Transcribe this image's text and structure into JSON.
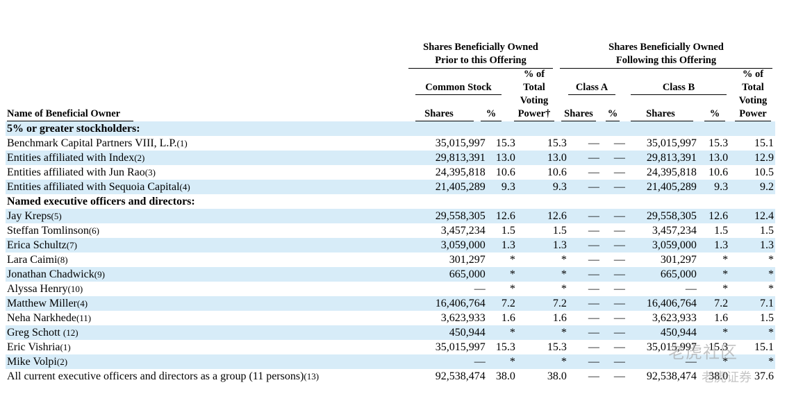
{
  "headers": {
    "group_prior_line1": "Shares Beneficially Owned",
    "group_prior_line2": "Prior to this Offering",
    "group_following_line1": "Shares Beneficially Owned",
    "group_following_line2": "Following this Offering",
    "common_stock": "Common Stock",
    "pct_total_voting_prior": [
      "% of",
      "Total",
      "Voting",
      "Power†"
    ],
    "class_a": "Class A",
    "class_b": "Class B",
    "pct_total_voting_following": [
      "% of",
      "Total",
      "Voting",
      "Power"
    ],
    "name_of_owner": "Name of Beneficial Owner",
    "shares": "Shares",
    "pct": "%"
  },
  "rows": [
    {
      "type": "section",
      "name": "5% or greater stockholders:"
    },
    {
      "name": "Benchmark Capital Partners VIII, L.P.",
      "fn": "(1)",
      "shares": "35,015,997",
      "pct": "15.3",
      "vp": "15.3",
      "a_sh": "—",
      "a_pct": "—",
      "b_sh": "35,015,997",
      "b_pct": "15.3",
      "b_vp": "15.1"
    },
    {
      "name": "Entities affiliated with Index",
      "fn": "(2)",
      "shares": "29,813,391",
      "pct": "13.0",
      "vp": "13.0",
      "a_sh": "—",
      "a_pct": "—",
      "b_sh": "29,813,391",
      "b_pct": "13.0",
      "b_vp": "12.9"
    },
    {
      "name": "Entities affiliated with Jun Rao",
      "fn": "(3)",
      "shares": "24,395,818",
      "pct": "10.6",
      "vp": "10.6",
      "a_sh": "—",
      "a_pct": "—",
      "b_sh": "24,395,818",
      "b_pct": "10.6",
      "b_vp": "10.5"
    },
    {
      "name": "Entities affiliated with Sequoia Capital",
      "fn": "(4)",
      "shares": "21,405,289",
      "pct": "9.3",
      "vp": "9.3",
      "a_sh": "—",
      "a_pct": "—",
      "b_sh": "21,405,289",
      "b_pct": "9.3",
      "b_vp": "9.2"
    },
    {
      "type": "section",
      "name": "Named executive officers and directors:"
    },
    {
      "name": "Jay Kreps",
      "fn": "(5)",
      "shares": "29,558,305",
      "pct": "12.6",
      "vp": "12.6",
      "a_sh": "—",
      "a_pct": "—",
      "b_sh": "29,558,305",
      "b_pct": "12.6",
      "b_vp": "12.4"
    },
    {
      "name": "Steffan Tomlinson",
      "fn": "(6)",
      "shares": "3,457,234",
      "pct": "1.5",
      "vp": "1.5",
      "a_sh": "—",
      "a_pct": "—",
      "b_sh": "3,457,234",
      "b_pct": "1.5",
      "b_vp": "1.5"
    },
    {
      "name": "Erica Schultz",
      "fn": "(7)",
      "shares": "3,059,000",
      "pct": "1.3",
      "vp": "1.3",
      "a_sh": "—",
      "a_pct": "—",
      "b_sh": "3,059,000",
      "b_pct": "1.3",
      "b_vp": "1.3"
    },
    {
      "name": "Lara Caimi",
      "fn": "(8)",
      "shares": "301,297",
      "pct": "*",
      "vp": "*",
      "a_sh": "—",
      "a_pct": "—",
      "b_sh": "301,297",
      "b_pct": "*",
      "b_vp": "*"
    },
    {
      "name": "Jonathan Chadwick",
      "fn": "(9)",
      "shares": "665,000",
      "pct": "*",
      "vp": "*",
      "a_sh": "—",
      "a_pct": "—",
      "b_sh": "665,000",
      "b_pct": "*",
      "b_vp": "*"
    },
    {
      "name": "Alyssa Henry",
      "fn": "(10)",
      "shares": "—",
      "pct": "*",
      "vp": "*",
      "a_sh": "—",
      "a_pct": "—",
      "b_sh": "—",
      "b_pct": "*",
      "b_vp": "*"
    },
    {
      "name": "Matthew Miller",
      "fn": "(4)",
      "shares": "16,406,764",
      "pct": "7.2",
      "vp": "7.2",
      "a_sh": "—",
      "a_pct": "—",
      "b_sh": "16,406,764",
      "b_pct": "7.2",
      "b_vp": "7.1"
    },
    {
      "name": "Neha Narkhede",
      "fn": "(11)",
      "shares": "3,623,933",
      "pct": "1.6",
      "vp": "1.6",
      "a_sh": "—",
      "a_pct": "—",
      "b_sh": "3,623,933",
      "b_pct": "1.6",
      "b_vp": "1.5"
    },
    {
      "name": "Greg Schott ",
      "fn": "(12)",
      "shares": "450,944",
      "pct": "*",
      "vp": "*",
      "a_sh": "—",
      "a_pct": "—",
      "b_sh": "450,944",
      "b_pct": "*",
      "b_vp": "*"
    },
    {
      "name": "Eric Vishria",
      "fn": "(1)",
      "shares": "35,015,997",
      "pct": "15.3",
      "vp": "15.3",
      "a_sh": "—",
      "a_pct": "—",
      "b_sh": "35,015,997",
      "b_pct": "15.3",
      "b_vp": "15.1"
    },
    {
      "name": "Mike Volpi",
      "fn": "(2)",
      "shares": "—",
      "pct": "*",
      "vp": "*",
      "a_sh": "—",
      "a_pct": "—",
      "b_sh": "—",
      "b_pct": "*",
      "b_vp": "*"
    },
    {
      "name": "All current executive officers and directors as a group (11 persons)",
      "fn": "(13)",
      "shares": "92,538,474",
      "pct": "38.0",
      "vp": "38.0",
      "a_sh": "—",
      "a_pct": "—",
      "b_sh": "92,538,474",
      "b_pct": "38.0",
      "b_vp": "37.6"
    }
  ],
  "watermark": {
    "line1": "老虎社区",
    "line2": "老虎证券"
  },
  "colors": {
    "row_shade": "#d7ecf8"
  }
}
